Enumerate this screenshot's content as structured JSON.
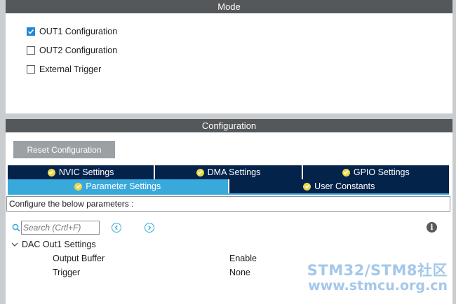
{
  "mode": {
    "title": "Mode",
    "options": [
      {
        "label": "OUT1 Configuration",
        "checked": true
      },
      {
        "label": "OUT2 Configuration",
        "checked": false
      },
      {
        "label": "External Trigger",
        "checked": false
      }
    ]
  },
  "configuration": {
    "title": "Configuration",
    "reset_label": "Reset Configuration",
    "tabs_row1": [
      "NVIC Settings",
      "DMA Settings",
      "GPIO Settings"
    ],
    "tabs_row2": [
      "Parameter Settings",
      "User Constants"
    ],
    "active_tab": "Parameter Settings",
    "description": "Configure the below parameters :",
    "search": {
      "placeholder": "Search (Crtl+F)",
      "value": ""
    },
    "group": {
      "label": "DAC Out1 Settings",
      "params": [
        {
          "name": "Output Buffer",
          "value": "Enable"
        },
        {
          "name": "Trigger",
          "value": "None"
        }
      ]
    }
  },
  "watermark": {
    "line1": "STM32/STM8社区",
    "line2": "www.stmcu.org.cn"
  },
  "colors": {
    "header": "#54585b",
    "tab": "#03234b",
    "tab_active": "#39a9dc",
    "check": "#1e88d8",
    "ok_icon": "#e9d94a"
  }
}
